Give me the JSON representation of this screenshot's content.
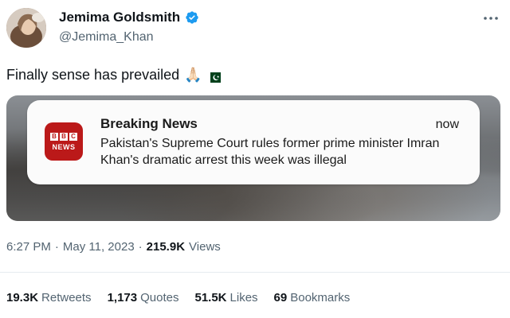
{
  "author": {
    "display_name": "Jemima Goldsmith",
    "handle": "@Jemima_Khan",
    "verified_color": "#1d9bf0"
  },
  "more_icon": "more-horizontal-icon",
  "tweet": {
    "text": "Finally sense has prevailed",
    "emoji_pray": "🙏🏻",
    "flag_icon": "pakistan-flag-icon"
  },
  "media": {
    "notification": {
      "app_logo_text": "BBC",
      "app_logo_subtext": "NEWS",
      "title": "Breaking News",
      "time": "now",
      "body": "Pakistan's Supreme Court rules former prime minister Imran Khan's dramatic arrest this week was illegal"
    }
  },
  "meta": {
    "time": "6:27 PM",
    "sep1": "·",
    "date": "May 11, 2023",
    "sep2": "·",
    "views_count": "215.9K",
    "views_label": "Views"
  },
  "stats": {
    "retweets_count": "19.3K",
    "retweets_label": "Retweets",
    "quotes_count": "1,173",
    "quotes_label": "Quotes",
    "likes_count": "51.5K",
    "likes_label": "Likes",
    "bookmarks_count": "69",
    "bookmarks_label": "Bookmarks"
  },
  "colors": {
    "bbc_red": "#bb1919",
    "secondary_text": "#536471",
    "primary_text": "#0f1419"
  }
}
